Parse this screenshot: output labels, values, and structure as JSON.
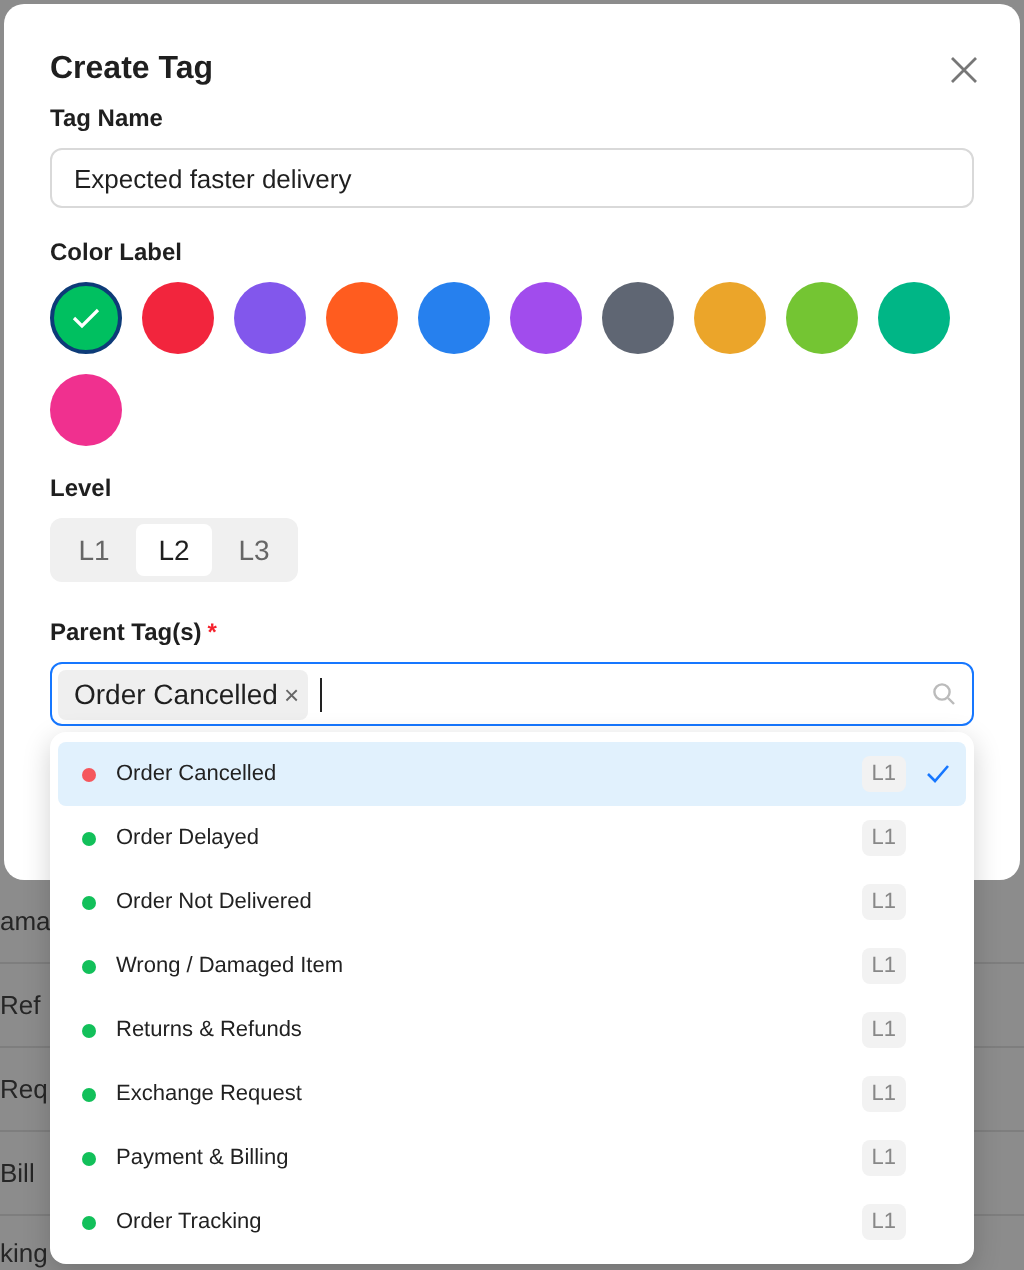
{
  "dialog": {
    "title": "Create Tag",
    "tag_name": {
      "label": "Tag Name",
      "value": "Expected faster delivery"
    },
    "color_label": {
      "label": "Color Label",
      "swatches": [
        {
          "color": "#00c060",
          "selected": true
        },
        {
          "color": "#f2253d",
          "selected": false
        },
        {
          "color": "#8257ec",
          "selected": false
        },
        {
          "color": "#ff5c1f",
          "selected": false
        },
        {
          "color": "#2680ee",
          "selected": false
        },
        {
          "color": "#a14ced",
          "selected": false
        },
        {
          "color": "#5f6673",
          "selected": false
        },
        {
          "color": "#eba52a",
          "selected": false
        },
        {
          "color": "#74c533",
          "selected": false
        },
        {
          "color": "#00b686",
          "selected": false
        },
        {
          "color": "#f0308f",
          "selected": false
        }
      ]
    },
    "level": {
      "label": "Level",
      "options": [
        {
          "label": "L1",
          "selected": false
        },
        {
          "label": "L2",
          "selected": true
        },
        {
          "label": "L3",
          "selected": false
        }
      ]
    },
    "parent_tags": {
      "label": "Parent Tag(s)",
      "required_mark": "*",
      "chips": [
        {
          "label": "Order Cancelled",
          "remove": "×"
        }
      ],
      "options": [
        {
          "label": "Order Cancelled",
          "level": "L1",
          "color": "#f5575c",
          "selected": true
        },
        {
          "label": "Order Delayed",
          "level": "L1",
          "color": "#12c05a",
          "selected": false
        },
        {
          "label": "Order Not Delivered",
          "level": "L1",
          "color": "#12c05a",
          "selected": false
        },
        {
          "label": "Wrong / Damaged Item",
          "level": "L1",
          "color": "#12c05a",
          "selected": false
        },
        {
          "label": "Returns & Refunds",
          "level": "L1",
          "color": "#12c05a",
          "selected": false
        },
        {
          "label": "Exchange Request",
          "level": "L1",
          "color": "#12c05a",
          "selected": false
        },
        {
          "label": "Payment & Billing",
          "level": "L1",
          "color": "#12c05a",
          "selected": false
        },
        {
          "label": "Order Tracking",
          "level": "L1",
          "color": "#12c05a",
          "selected": false
        }
      ]
    }
  },
  "background_rows": [
    "ama",
    "Ref",
    "Req",
    "Bill",
    "king"
  ]
}
